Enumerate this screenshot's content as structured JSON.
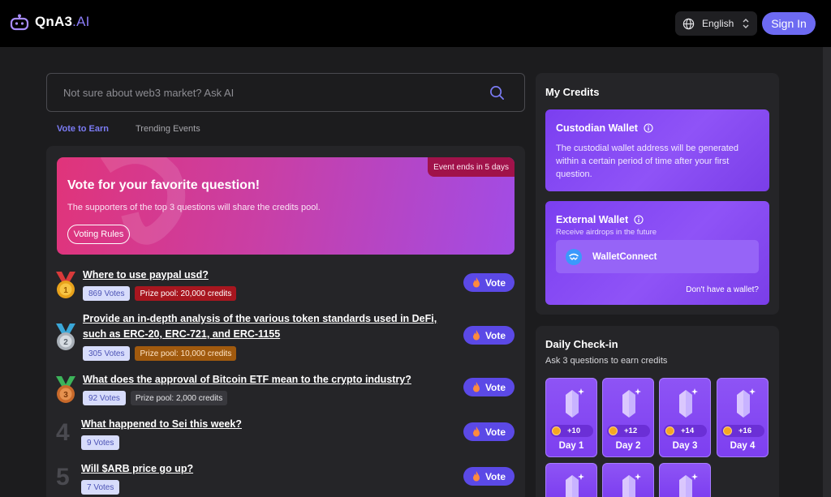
{
  "header": {
    "logo_text": "QnA3",
    "logo_suffix": ".AI",
    "language": "English",
    "sign_in": "Sign In"
  },
  "search": {
    "placeholder": "Not sure about web3 market? Ask AI"
  },
  "tabs": [
    {
      "label": "Vote to Earn",
      "active": true
    },
    {
      "label": "Trending Events",
      "active": false
    }
  ],
  "banner": {
    "badge": "Event ends in 5 days",
    "title": "Vote for your favorite question!",
    "subtitle": "The supporters of the top 3 questions will share the credits pool.",
    "rules_button": "Voting Rules"
  },
  "questions": [
    {
      "rank": "1",
      "title": "Where to use paypal usd?",
      "votes": "869 Votes",
      "prize": "Prize pool:  20,000 credits"
    },
    {
      "rank": "2",
      "title": "Provide an in-depth analysis of the various token standards used in DeFi, such as ERC-20, ERC-721, and ERC-1155",
      "votes": "305 Votes",
      "prize": "Prize pool:  10,000 credits"
    },
    {
      "rank": "3",
      "title": "What does the approval of Bitcoin ETF mean to the crypto industry?",
      "votes": "92 Votes",
      "prize": "Prize pool: 2,000 credits"
    },
    {
      "rank": "4",
      "title": "What happened to Sei this week?",
      "votes": "9 Votes"
    },
    {
      "rank": "5",
      "title": "Will $ARB price go up?",
      "votes": "7 Votes"
    }
  ],
  "vote_label": "Vote",
  "credits": {
    "title": "My Credits",
    "custodian": {
      "title": "Custodian Wallet",
      "text": "The custodial wallet address will be generated within a certain period of time after your first question."
    },
    "external": {
      "title": "External Wallet",
      "subtitle": "Receive airdrops in the future",
      "walletconnect": "WalletConnect",
      "no_wallet": "Don't have a wallet?"
    }
  },
  "checkin": {
    "title": "Daily Check-in",
    "subtitle": "Ask 3 questions to earn credits",
    "days": [
      {
        "reward": "+10",
        "label": "Day 1"
      },
      {
        "reward": "+12",
        "label": "Day 2"
      },
      {
        "reward": "+14",
        "label": "Day 3"
      },
      {
        "reward": "+16",
        "label": "Day 4"
      }
    ]
  },
  "colors": {
    "accent": "#6d6af2",
    "vote_button": "#5b49e6",
    "card_purple": "#8f53f7",
    "background": "#1c1c1e"
  }
}
